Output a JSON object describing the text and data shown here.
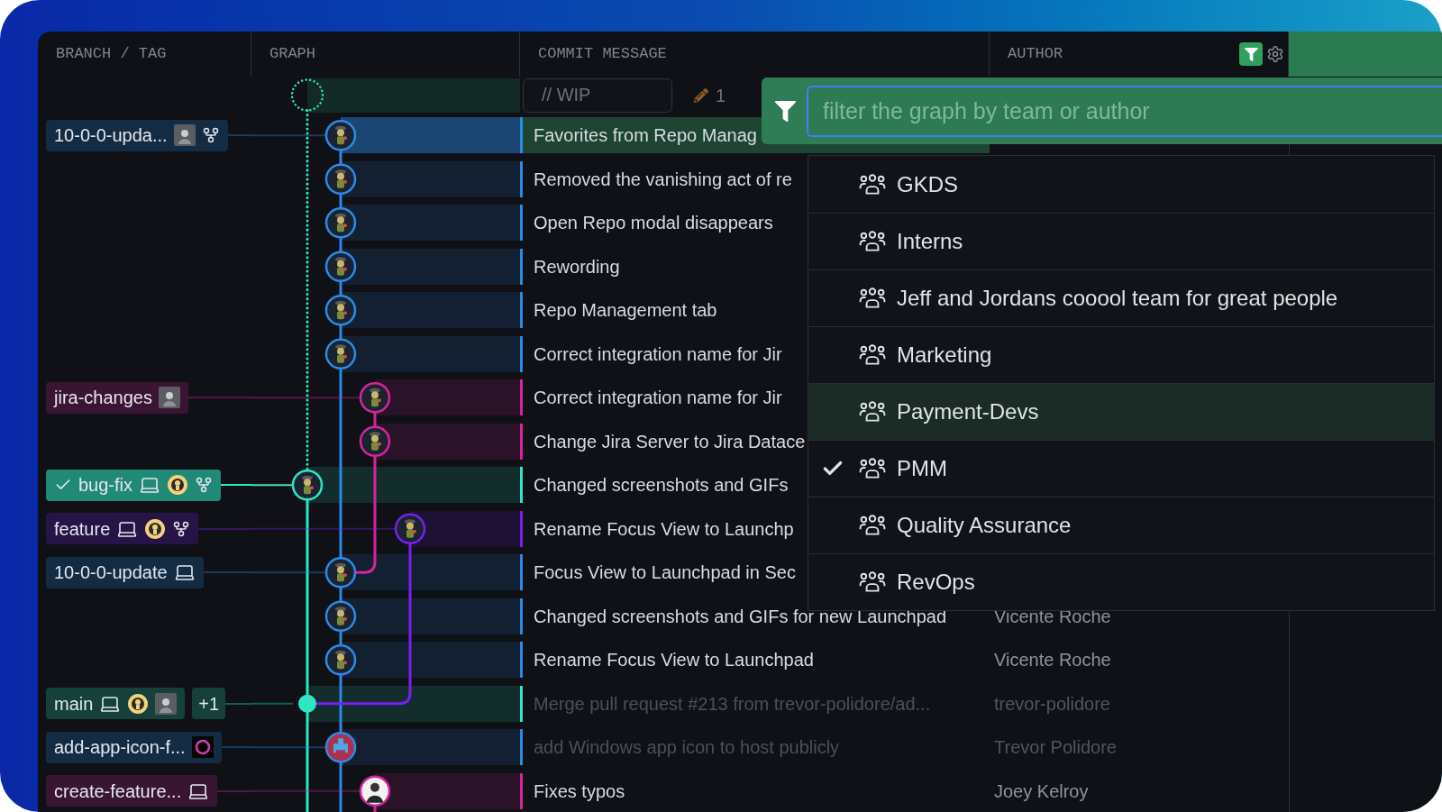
{
  "columns": [
    {
      "label": "BRANCH / TAG"
    },
    {
      "label": "GRAPH"
    },
    {
      "label": "COMMIT MESSAGE"
    },
    {
      "label": "AUTHOR"
    }
  ],
  "header_tools": {
    "filter_active": true
  },
  "wip": {
    "placeholder": "// WIP",
    "changes": "1"
  },
  "rows": [
    {
      "color": "#2b8ae6",
      "selected": true,
      "node": {
        "kind": "avatar"
      },
      "message": "Favorites from Repo Manag",
      "dimmed": false,
      "branch": {
        "name": "10-0-0-upda...",
        "current": false,
        "icons": [
          {
            "kind": "avatar"
          },
          {
            "kind": "fork"
          }
        ]
      }
    },
    {
      "color": "#2b8ae6",
      "selected": false,
      "node": {
        "kind": "avatar"
      },
      "message": "Removed the vanishing act of re",
      "dimmed": false
    },
    {
      "color": "#2b8ae6",
      "selected": false,
      "node": {
        "kind": "avatar"
      },
      "message": "Open Repo modal disappears",
      "dimmed": false
    },
    {
      "color": "#2b8ae6",
      "selected": false,
      "node": {
        "kind": "avatar"
      },
      "message": "Rewording",
      "dimmed": false
    },
    {
      "color": "#2b8ae6",
      "selected": false,
      "node": {
        "kind": "avatar"
      },
      "message": "Repo Management tab",
      "dimmed": false
    },
    {
      "color": "#2b8ae6",
      "selected": false,
      "node": {
        "kind": "avatar"
      },
      "message": "Correct integration name for Jir",
      "dimmed": false
    },
    {
      "color": "#d8239c",
      "selected": false,
      "node": {
        "kind": "avatar"
      },
      "message": "Correct integration name for Jir",
      "dimmed": false,
      "branch": {
        "name": "jira-changes",
        "current": false,
        "icons": [
          {
            "kind": "avatar"
          }
        ]
      }
    },
    {
      "color": "#d8239c",
      "selected": false,
      "node": {
        "kind": "avatar"
      },
      "message": "Change Jira Server to Jira Datace",
      "dimmed": false
    },
    {
      "color": "#2ee6c2",
      "selected": false,
      "node": {
        "kind": "avatar"
      },
      "message": "Changed screenshots and GIFs",
      "dimmed": false,
      "branch": {
        "name": "bug-fix",
        "current": true,
        "icons": [
          {
            "kind": "laptop"
          },
          {
            "kind": "remote"
          },
          {
            "kind": "fork"
          }
        ]
      }
    },
    {
      "color": "#7a1ff0",
      "selected": false,
      "node": {
        "kind": "avatar"
      },
      "message": "Rename Focus View to Launchp",
      "dimmed": false,
      "branch": {
        "name": "feature",
        "current": false,
        "icons": [
          {
            "kind": "laptop"
          },
          {
            "kind": "remote"
          },
          {
            "kind": "fork"
          }
        ]
      }
    },
    {
      "color": "#2b8ae6",
      "selected": false,
      "node": {
        "kind": "avatar"
      },
      "message": "Focus View to Launchpad in Sec",
      "dimmed": false,
      "branch": {
        "name": "10-0-0-update",
        "current": false,
        "icons": [
          {
            "kind": "laptop"
          }
        ]
      }
    },
    {
      "color": "#2b8ae6",
      "selected": false,
      "node": {
        "kind": "avatar"
      },
      "message": "Changed screenshots and GIFs for new Launchpad",
      "dimmed": false,
      "author": "Vicente Roche"
    },
    {
      "color": "#2b8ae6",
      "selected": false,
      "node": {
        "kind": "avatar"
      },
      "message": "Rename Focus View to Launchpad",
      "dimmed": false,
      "author": "Vicente Roche"
    },
    {
      "color": "#2ee6c2",
      "selected": false,
      "node": {
        "kind": "merge"
      },
      "message": "Merge pull request #213 from trevor-polidore/ad...",
      "dimmed": true,
      "author": "trevor-polidore",
      "branch": {
        "name": "main",
        "current": false,
        "icons": [
          {
            "kind": "laptop"
          },
          {
            "kind": "remote"
          },
          {
            "kind": "avatar"
          }
        ],
        "extra": "+1"
      }
    },
    {
      "color": "#2b8ae6",
      "selected": false,
      "node": {
        "kind": "app"
      },
      "message": "add Windows app icon to host publicly",
      "dimmed": true,
      "author": "Trevor Polidore",
      "branch": {
        "name": "add-app-icon-f...",
        "current": false,
        "icons": [
          {
            "kind": "ring"
          }
        ]
      }
    },
    {
      "color": "#d8239c",
      "selected": false,
      "node": {
        "kind": "photo"
      },
      "message": "Fixes typos",
      "dimmed": false,
      "author": "Joey Kelroy",
      "branch": {
        "name": "create-feature...",
        "current": false,
        "icons": [
          {
            "kind": "laptop"
          }
        ]
      }
    }
  ],
  "filter": {
    "placeholder": "filter the graph by team or author",
    "teams": [
      {
        "name": "GKDS",
        "checked": false,
        "hovered": false
      },
      {
        "name": "Interns",
        "checked": false,
        "hovered": false
      },
      {
        "name": "Jeff and Jordans cooool team for great people",
        "checked": false,
        "hovered": false
      },
      {
        "name": "Marketing",
        "checked": false,
        "hovered": false
      },
      {
        "name": "Payment-Devs",
        "checked": false,
        "hovered": true
      },
      {
        "name": "PMM",
        "checked": true,
        "hovered": false
      },
      {
        "name": "Quality Assurance",
        "checked": false,
        "hovered": false
      },
      {
        "name": "RevOps",
        "checked": false,
        "hovered": false
      }
    ]
  }
}
